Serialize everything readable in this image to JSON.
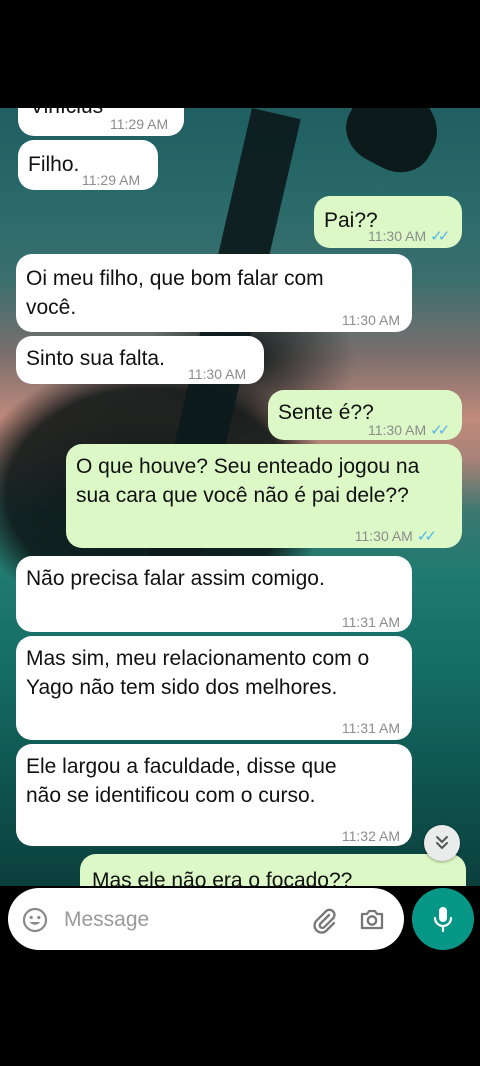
{
  "messages": [
    {
      "text": "Vinícius",
      "time": "11:29 AM",
      "dir": "in"
    },
    {
      "text": "Filho.",
      "time": "11:29 AM",
      "dir": "in"
    },
    {
      "text": "Pai??",
      "time": "11:30 AM",
      "dir": "out",
      "read": true
    },
    {
      "text": "Oi meu filho, que bom falar com você.",
      "time": "11:30 AM",
      "dir": "in"
    },
    {
      "text": "Sinto sua falta.",
      "time": "11:30 AM",
      "dir": "in"
    },
    {
      "text": "Sente é??",
      "time": "11:30 AM",
      "dir": "out",
      "read": true
    },
    {
      "text": "O que houve? Seu enteado jogou na sua cara que você não é pai dele??",
      "time": "11:30 AM",
      "dir": "out",
      "read": true
    },
    {
      "text": "Não precisa falar assim comigo.",
      "time": "11:31 AM",
      "dir": "in"
    },
    {
      "text": "Mas sim, meu relacionamento com o Yago não tem sido dos melhores.",
      "time": "11:31 AM",
      "dir": "in"
    },
    {
      "text": "Ele largou a faculdade, disse que não se identificou com o curso.",
      "time": "11:32 AM",
      "dir": "in"
    },
    {
      "text": "Mas ele não era o focado??",
      "time": "",
      "dir": "out"
    }
  ],
  "composer": {
    "placeholder": "Message",
    "icons": [
      "emoji-icon",
      "attach-icon",
      "camera-icon"
    ],
    "send_icon": "mic-icon"
  },
  "colors": {
    "incoming_bubble": "#ffffff",
    "outgoing_bubble": "#dcf8c6",
    "read_ticks": "#4fb6ec",
    "mic_button": "#079787"
  }
}
